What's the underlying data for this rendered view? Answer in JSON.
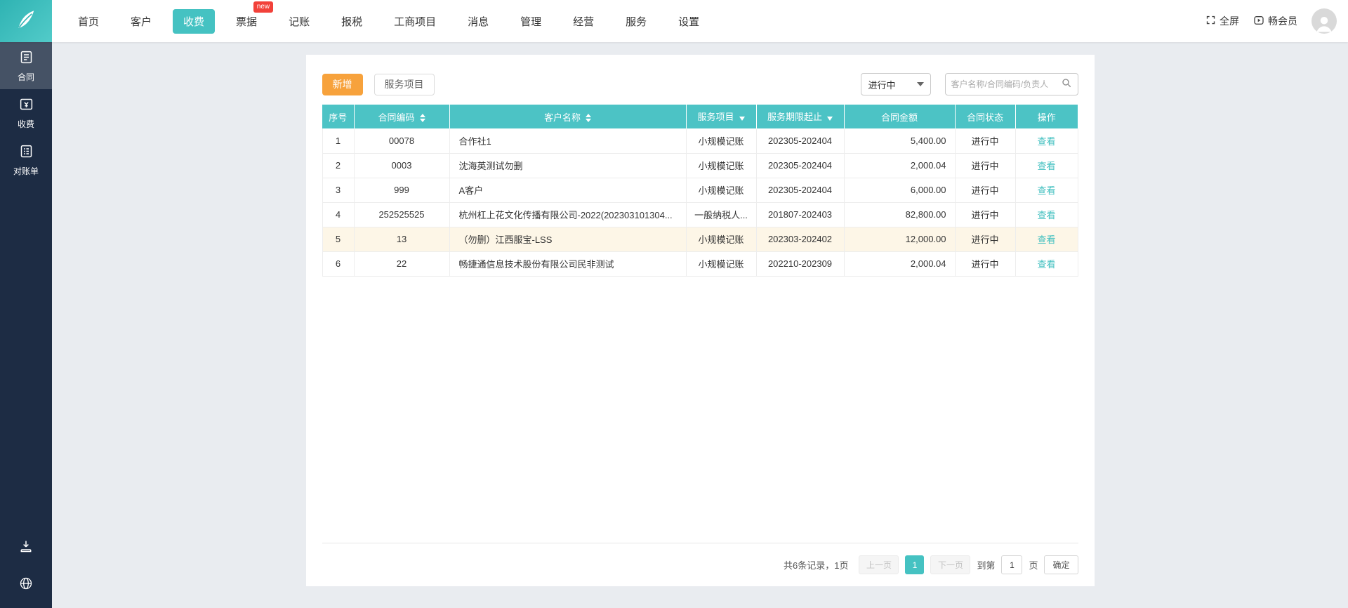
{
  "topnav": {
    "items": [
      {
        "label": "首页"
      },
      {
        "label": "客户"
      },
      {
        "label": "收费",
        "active": true
      },
      {
        "label": "票据",
        "badge": "new"
      },
      {
        "label": "记账"
      },
      {
        "label": "报税"
      },
      {
        "label": "工商项目"
      },
      {
        "label": "消息"
      },
      {
        "label": "管理"
      },
      {
        "label": "经营"
      },
      {
        "label": "服务"
      },
      {
        "label": "设置"
      }
    ],
    "right": {
      "fullscreen_label": "全屏",
      "member_label": "畅会员"
    }
  },
  "sidebar": {
    "items": [
      {
        "label": "合同",
        "icon": "contract-icon",
        "active": true
      },
      {
        "label": "收费",
        "icon": "fee-icon"
      },
      {
        "label": "对账单",
        "icon": "statement-icon"
      }
    ],
    "bottom_icons": [
      "download-icon",
      "globe-icon"
    ]
  },
  "toolbar": {
    "add_label": "新增",
    "service_label": "服务项目",
    "status_filter_value": "进行中",
    "search_placeholder": "客户名称/合同编码/负责人",
    "search_icon": "search-icon"
  },
  "table": {
    "headers": [
      "序号",
      "合同编码",
      "客户名称",
      "服务项目",
      "服务期限起止",
      "合同金额",
      "合同状态",
      "操作"
    ],
    "rows": [
      {
        "seq": "1",
        "code": "00078",
        "customer": "合作社1",
        "service": "小规模记账",
        "period": "202305-202404",
        "amount": "5,400.00",
        "status": "进行中",
        "action": "查看"
      },
      {
        "seq": "2",
        "code": "0003",
        "customer": "沈海英测试勿删",
        "service": "小规模记账",
        "period": "202305-202404",
        "amount": "2,000.04",
        "status": "进行中",
        "action": "查看"
      },
      {
        "seq": "3",
        "code": "999",
        "customer": "A客户",
        "service": "小规模记账",
        "period": "202305-202404",
        "amount": "6,000.00",
        "status": "进行中",
        "action": "查看"
      },
      {
        "seq": "4",
        "code": "252525525",
        "customer": "杭州杠上花文化传播有限公司-2022(202303101304...",
        "service": "一般纳税人...",
        "period": "201807-202403",
        "amount": "82,800.00",
        "status": "进行中",
        "action": "查看"
      },
      {
        "seq": "5",
        "code": "13",
        "customer": "（勿删）江西服宝-LSS",
        "service": "小规模记账",
        "period": "202303-202402",
        "amount": "12,000.00",
        "status": "进行中",
        "action": "查看",
        "highlighted": true
      },
      {
        "seq": "6",
        "code": "22",
        "customer": "畅捷通信息技术股份有限公司民非测试",
        "service": "小规模记账",
        "period": "202210-202309",
        "amount": "2,000.04",
        "status": "进行中",
        "action": "查看"
      }
    ]
  },
  "pagination": {
    "summary": "共6条记录，1页",
    "prev_label": "上一页",
    "current_page": "1",
    "next_label": "下一页",
    "goto_prefix": "到第",
    "goto_value": "1",
    "goto_suffix": "页",
    "confirm_label": "确定"
  },
  "colors": {
    "accent_teal": "#45c2c2",
    "table_header_teal": "#4cc3c5",
    "accent_orange": "#f7a23c",
    "sidebar_bg": "#1d2c44",
    "badge_red": "#f2413a",
    "highlight_row": "#fdf6e7"
  },
  "icons": {
    "logo": "leaf-icon",
    "fullscreen": "fullscreen-icon",
    "member": "play-circle-icon",
    "avatar": "user-avatar",
    "search": "search-icon"
  }
}
